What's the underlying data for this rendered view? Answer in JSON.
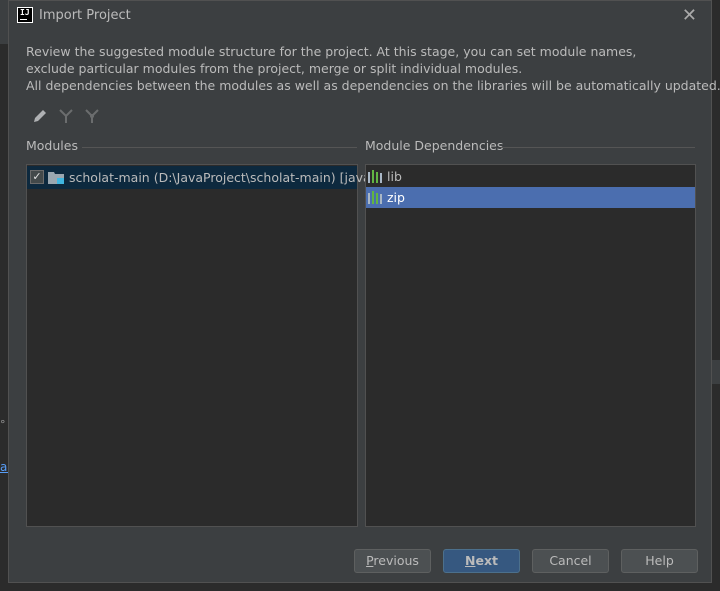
{
  "dialog": {
    "title": "Import Project",
    "app_icon_text": "IJ",
    "close_icon": "close-icon"
  },
  "description": {
    "line1": "Review the suggested module structure for the project. At this stage, you can set module names,",
    "line2": "exclude particular modules from the project, merge or split individual modules.",
    "line3": "All dependencies between the modules as well as dependencies on the libraries will be automatically updated."
  },
  "toolbar": {
    "items": [
      "pencil-icon",
      "merge-icon",
      "split-icon"
    ]
  },
  "modules": {
    "label": "Modules",
    "items": [
      {
        "text": "scholat-main (D:\\JavaProject\\scholat-main) [java]",
        "checked": true
      }
    ]
  },
  "dependencies": {
    "label": "Module Dependencies",
    "items": [
      {
        "text": "lib",
        "selected": false
      },
      {
        "text": "zip",
        "selected": true
      }
    ]
  },
  "buttons": {
    "previous_mnemonic": "P",
    "previous_rest": "revious",
    "next_mnemonic": "N",
    "next_rest": "ext",
    "cancel": "Cancel",
    "help": "Help"
  },
  "colors": {
    "dialog_bg": "#3c3f41",
    "panel_bg": "#2b2b2b",
    "selection": "#4b6eaf",
    "inactive_selection": "#0d293e",
    "primary_button": "#365880"
  }
}
